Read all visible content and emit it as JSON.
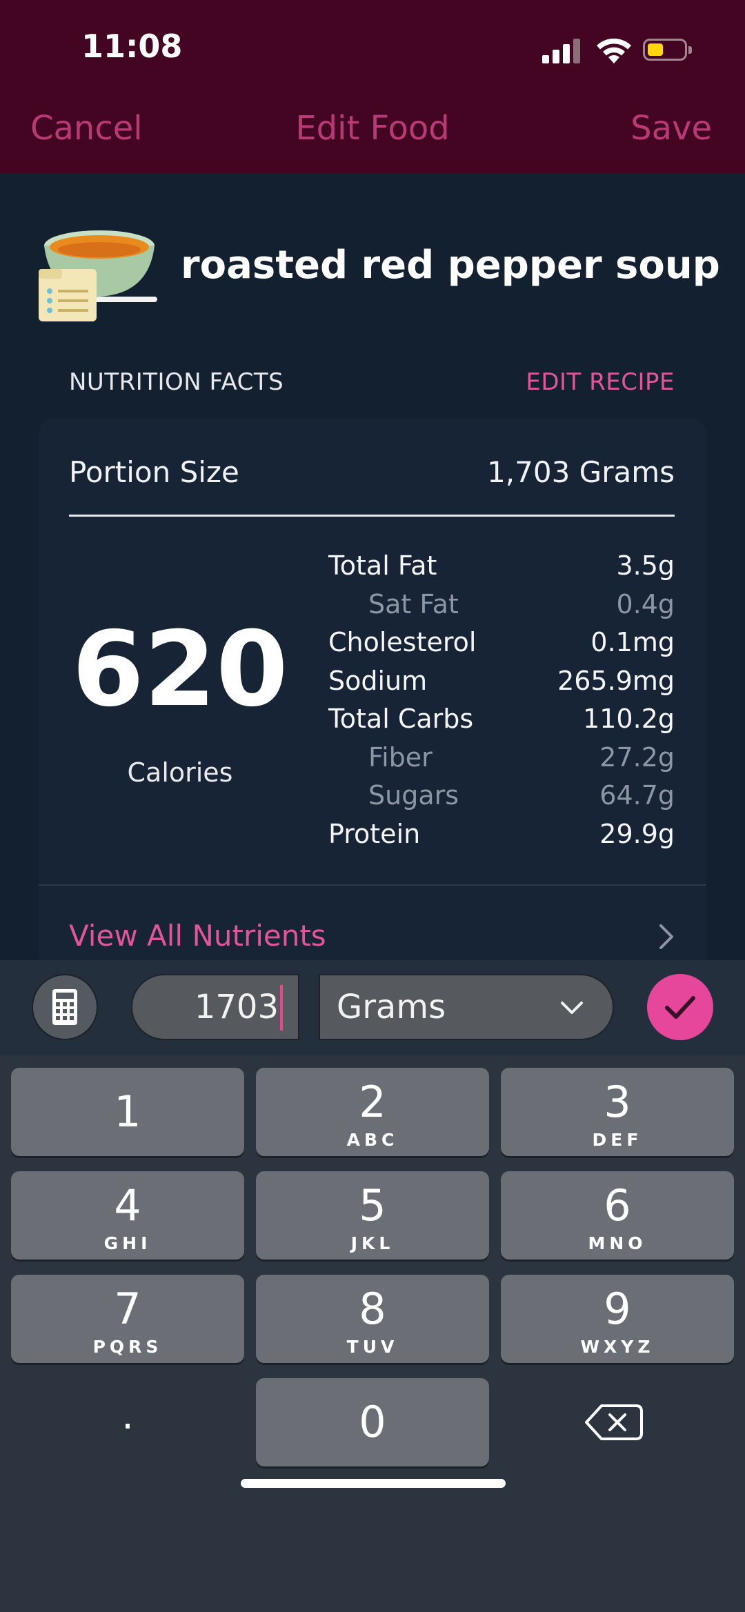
{
  "status_bar": {
    "time": "11:08"
  },
  "nav": {
    "cancel_label": "Cancel",
    "title": "Edit Food",
    "save_label": "Save"
  },
  "food": {
    "name": "roasted red pepper soup"
  },
  "section": {
    "title": "NUTRITION FACTS",
    "edit_recipe_label": "EDIT RECIPE"
  },
  "portion": {
    "label": "Portion Size",
    "value": "1,703 Grams"
  },
  "calories": {
    "value": "620",
    "label": "Calories"
  },
  "nutrients": [
    {
      "label": "Total Fat",
      "value": "3.5g"
    },
    {
      "label": "Sat Fat",
      "value": "0.4g"
    },
    {
      "label": "Cholesterol",
      "value": "0.1mg"
    },
    {
      "label": "Sodium",
      "value": "265.9mg"
    },
    {
      "label": "Total Carbs",
      "value": "110.2g"
    },
    {
      "label": "Fiber",
      "value": "27.2g"
    },
    {
      "label": "Sugars",
      "value": "64.7g"
    },
    {
      "label": "Protein",
      "value": "29.9g"
    }
  ],
  "view_all_label": "View All Nutrients",
  "input": {
    "quantity": "1703",
    "unit": "Grams"
  },
  "keyboard": {
    "keys": [
      {
        "digit": "1",
        "letters": ""
      },
      {
        "digit": "2",
        "letters": "ABC"
      },
      {
        "digit": "3",
        "letters": "DEF"
      },
      {
        "digit": "4",
        "letters": "GHI"
      },
      {
        "digit": "5",
        "letters": "JKL"
      },
      {
        "digit": "6",
        "letters": "MNO"
      },
      {
        "digit": "7",
        "letters": "PQRS"
      },
      {
        "digit": "8",
        "letters": "TUV"
      },
      {
        "digit": "9",
        "letters": "WXYZ"
      },
      {
        "digit": "0",
        "letters": ""
      }
    ],
    "decimal_label": "."
  },
  "colors": {
    "header_bg": "#430521",
    "page_bg": "#13202f",
    "accent_pink": "#e15699",
    "confirm_bg": "#e6479a"
  }
}
